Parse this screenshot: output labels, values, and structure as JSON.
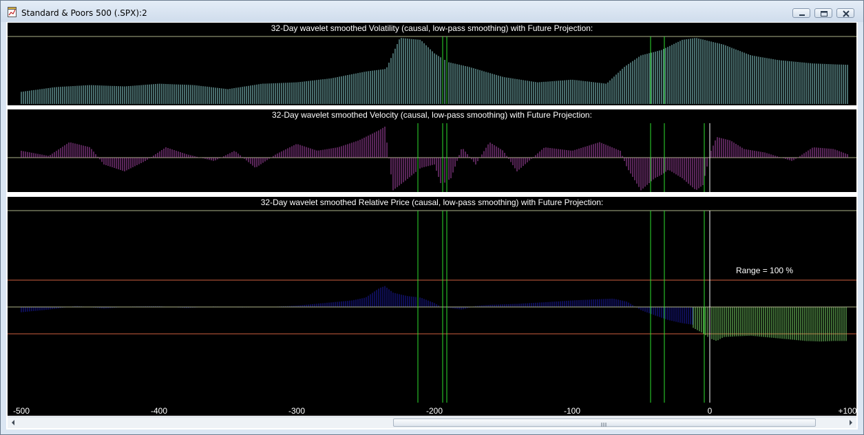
{
  "window": {
    "title": "Standard & Poors 500 (.SPX):2",
    "icon": "chart-document-icon",
    "controls": [
      "minimize-icon",
      "maximize-icon",
      "close-icon"
    ]
  },
  "panels": [
    {
      "id": "volatility",
      "title": "32-Day wavelet smoothed Volatility (causal, low-pass smoothing) with Future Projection:",
      "color": "#8fd9d9"
    },
    {
      "id": "velocity",
      "title": "32-Day wavelet smoothed Velocity (causal, low-pass smoothing) with Future Projection:",
      "color": "#b04ab0"
    },
    {
      "id": "price",
      "title": "32-Day wavelet smoothed Relative Price (causal, low-pass smoothing) with Future Projection:",
      "color": "#1c1ca8",
      "projection_color": "#7bd86a",
      "range_label": "Range = 100 %"
    }
  ],
  "colors": {
    "background": "#000000",
    "grid_line": "#aeb58a",
    "marker_line": "#2ee02e",
    "now_line": "#ffffff",
    "range_line": "#d06040"
  },
  "chart_data": {
    "type": "bar",
    "x_range": [
      -500,
      100
    ],
    "x_ticks": [
      "-500",
      "-400",
      "-300",
      "-200",
      "-100",
      "0",
      "+100"
    ],
    "marker_lines_x": [
      -212,
      -194,
      -191,
      -43,
      -33,
      -4
    ],
    "now_line_x": 0,
    "series": [
      {
        "name": "Volatility",
        "x": [
          -500,
          -475,
          -450,
          -425,
          -400,
          -375,
          -350,
          -325,
          -300,
          -275,
          -250,
          -235,
          -225,
          -210,
          -200,
          -190,
          -175,
          -150,
          -125,
          -100,
          -75,
          -62,
          -50,
          -35,
          -20,
          -10,
          10,
          30,
          50,
          75,
          100
        ],
        "values": [
          0.18,
          0.25,
          0.28,
          0.26,
          0.3,
          0.28,
          0.22,
          0.3,
          0.32,
          0.38,
          0.48,
          0.52,
          0.98,
          0.95,
          0.75,
          0.62,
          0.55,
          0.4,
          0.32,
          0.36,
          0.3,
          0.55,
          0.72,
          0.8,
          0.95,
          0.98,
          0.88,
          0.72,
          0.65,
          0.6,
          0.58
        ]
      },
      {
        "name": "Velocity",
        "x": [
          -500,
          -480,
          -465,
          -450,
          -440,
          -425,
          -410,
          -395,
          -380,
          -360,
          -345,
          -330,
          -315,
          -300,
          -285,
          -270,
          -255,
          -240,
          -236,
          -230,
          -222,
          -210,
          -200,
          -195,
          -188,
          -180,
          -170,
          -160,
          -150,
          -140,
          -120,
          -100,
          -80,
          -65,
          -60,
          -50,
          -40,
          -35,
          -30,
          -20,
          -10,
          -5,
          0,
          5,
          15,
          25,
          40,
          60,
          75,
          90,
          100
        ],
        "values": [
          0.2,
          0.05,
          0.45,
          0.3,
          -0.2,
          -0.4,
          -0.1,
          0.3,
          0.1,
          -0.1,
          0.2,
          -0.3,
          0.1,
          0.4,
          0.2,
          0.3,
          0.5,
          0.8,
          0.9,
          -0.95,
          -0.7,
          -0.3,
          -0.2,
          -0.8,
          -0.6,
          0.3,
          -0.2,
          0.45,
          0.2,
          -0.4,
          0.3,
          0.2,
          0.45,
          0.2,
          -0.3,
          -0.95,
          -0.6,
          -0.5,
          -0.35,
          -0.6,
          -0.95,
          -0.8,
          0.1,
          0.6,
          0.5,
          0.25,
          0.15,
          -0.1,
          0.3,
          0.25,
          0.1
        ]
      },
      {
        "name": "Relative Price",
        "x": [
          -500,
          -480,
          -460,
          -440,
          -420,
          -400,
          -380,
          -360,
          -340,
          -320,
          -300,
          -280,
          -260,
          -250,
          -240,
          -236,
          -230,
          -220,
          -210,
          -200,
          -195,
          -190,
          -180,
          -170,
          -160,
          -150,
          -140,
          -120,
          -100,
          -80,
          -70,
          -60,
          -50,
          -40,
          -30,
          -20,
          -12
        ],
        "values": [
          -0.2,
          -0.1,
          0.04,
          -0.06,
          0.02,
          0.03,
          -0.04,
          0.02,
          -0.02,
          0.0,
          0.05,
          0.15,
          0.25,
          0.36,
          0.72,
          0.8,
          0.55,
          0.42,
          0.36,
          0.15,
          0.0,
          -0.03,
          -0.1,
          0.04,
          0.08,
          0.1,
          0.12,
          0.18,
          0.25,
          0.3,
          0.32,
          0.2,
          -0.12,
          -0.32,
          -0.5,
          -0.62,
          -0.68
        ]
      },
      {
        "name": "Future Projection",
        "x": [
          -12,
          -5,
          0,
          5,
          10,
          20,
          30,
          40,
          50,
          60,
          70,
          80,
          90,
          100
        ],
        "values": [
          -0.8,
          -1.0,
          -1.2,
          -1.3,
          -1.15,
          -1.12,
          -1.1,
          -1.15,
          -1.2,
          -1.25,
          -1.3,
          -1.32,
          -1.3,
          -1.3
        ]
      }
    ]
  },
  "scrollbar": {
    "left_arrow": "scroll-left-icon",
    "right_arrow": "scroll-right-icon",
    "grip": "grip-icon"
  }
}
